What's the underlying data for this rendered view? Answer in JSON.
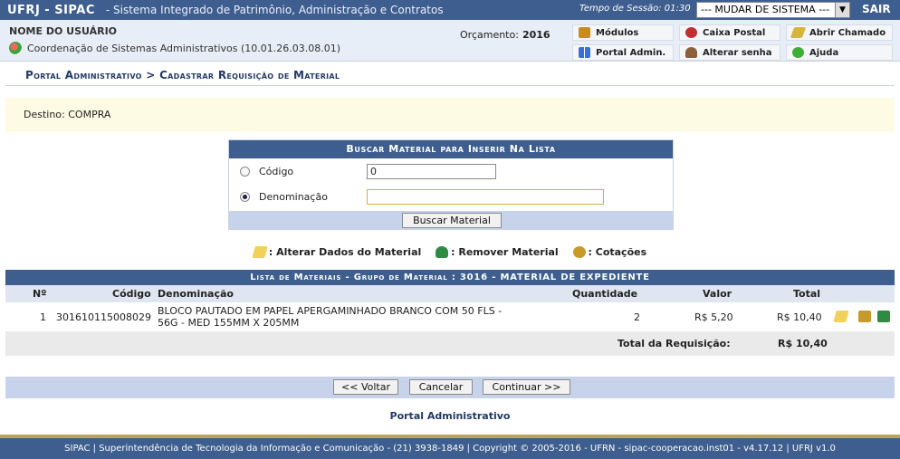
{
  "header": {
    "brand": "UFRJ - SIPAC",
    "subtitle": "- Sistema Integrado de Patrimônio, Administração e Contratos",
    "session_label": "Tempo de Sessão: 01:30",
    "system_select": "--- MUDAR DE SISTEMA ---",
    "logout": "SAIR"
  },
  "user": {
    "name": "NOME DO USUÁRIO",
    "unit": "Coordenação de Sistemas Administrativos (10.01.26.03.08.01)",
    "budget_label": "Orçamento:",
    "budget_year": "2016"
  },
  "quick_links": {
    "modulos": "Módulos",
    "caixa_postal": "Caixa Postal",
    "abrir_chamado": "Abrir Chamado",
    "portal_admin": "Portal Admin.",
    "alterar_senha": "Alterar senha",
    "ajuda": "Ajuda"
  },
  "breadcrumb": "Portal Administrativo > Cadastrar Requisição de Material",
  "destino": "Destino: COMPRA",
  "search": {
    "caption": "Buscar Material para Inserir Na Lista",
    "codigo_label": "Código",
    "codigo_value": "0",
    "denominacao_label": "Denominação",
    "denominacao_value": "",
    "button": "Buscar Material"
  },
  "legend": {
    "edit": ": Alterar Dados do Material",
    "remove": ": Remover Material",
    "quotes": ": Cotações"
  },
  "list": {
    "caption": "Lista de Materiais - Grupo de Material : 3016 - MATERIAL DE EXPEDIENTE",
    "columns": {
      "num": "Nº",
      "codigo": "Código",
      "denominacao": "Denominação",
      "quantidade": "Quantidade",
      "valor": "Valor",
      "total": "Total"
    },
    "rows": [
      {
        "num": "1",
        "codigo": "301610115008029",
        "denominacao_line1": "BLOCO PAUTADO EM PAPEL APERGAMINHADO BRANCO COM 50 FLS -",
        "denominacao_line2": "56G - MED 155MM X 205MM",
        "quantidade": "2",
        "valor": "R$ 5,20",
        "total": "R$ 10,40"
      }
    ],
    "total_label": "Total da Requisição:",
    "total_value": "R$ 10,40"
  },
  "actions": {
    "back": "<< Voltar",
    "cancel": "Cancelar",
    "continue": "Continuar >>"
  },
  "portal_link": "Portal Administrativo",
  "footer": "SIPAC | Superintendência de Tecnologia da Informação e Comunicação - (21) 3938-1849 | Copyright © 2005-2016 - UFRN - sipac-cooperacao.inst01 - v4.17.12 | UFRJ v1.0"
}
